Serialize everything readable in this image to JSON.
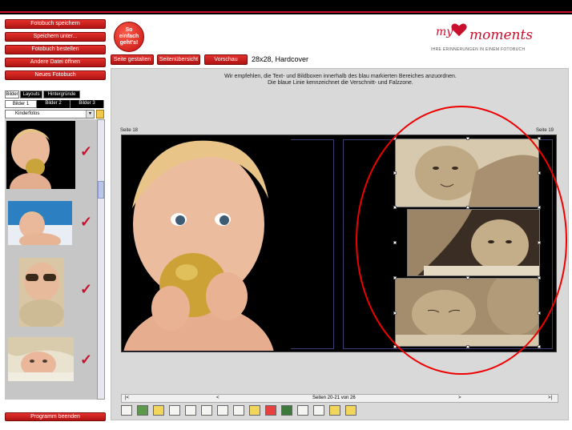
{
  "left_buttons": [
    "Fotobuch speichern",
    "Speichern unter...",
    "Fotobuch bestellen",
    "Andere Datei öffnen",
    "Neues Fotobuch"
  ],
  "badge": {
    "line1": "So",
    "line2": "einfach",
    "line3": "geht's!"
  },
  "logo": {
    "my": "my",
    "moments": "moments",
    "tagline": "IHRE ERINNERUNGEN IN EINEM FOTOBUCH"
  },
  "toolbar": {
    "page_design": "Seite gestalten",
    "page_view": "Seitenübersicht",
    "preview": "Vorschau"
  },
  "format_label": "28x28, Hardcover",
  "tabs": [
    "Bilder",
    "Layouts",
    "Hintergründe"
  ],
  "subtabs": [
    "Bilder 1",
    "Bilder 2",
    "Bilder 3"
  ],
  "folder_select": "Kinderfotos",
  "instructions": {
    "line1": "Wir empfehlen, die Text- und Bildboxen innerhalb des blau markierten Bereiches anzuordnen.",
    "line2": "Die blaue Linie kennzeichnet die Verschnitt- und Falzzone."
  },
  "page_left": "Seite 18",
  "page_right": "Seite 19",
  "pager": {
    "first": "|<",
    "prev": "<",
    "text": "Seiten 20-21 von 26",
    "next": ">",
    "last": ">|"
  },
  "exit_button": "Programm beenden",
  "colors": {
    "accent": "#c8102e",
    "workspace": "#d9d9d9",
    "sepia": "#8a7355"
  },
  "icons": [
    "text-icon",
    "image-icon",
    "layer-icon",
    "undo-icon",
    "redo-icon",
    "print-icon",
    "align-icon",
    "align2-icon",
    "number-icon",
    "crop-icon",
    "color-icon",
    "copy-icon",
    "distribute-icon",
    "page-icon",
    "grid-icon"
  ]
}
